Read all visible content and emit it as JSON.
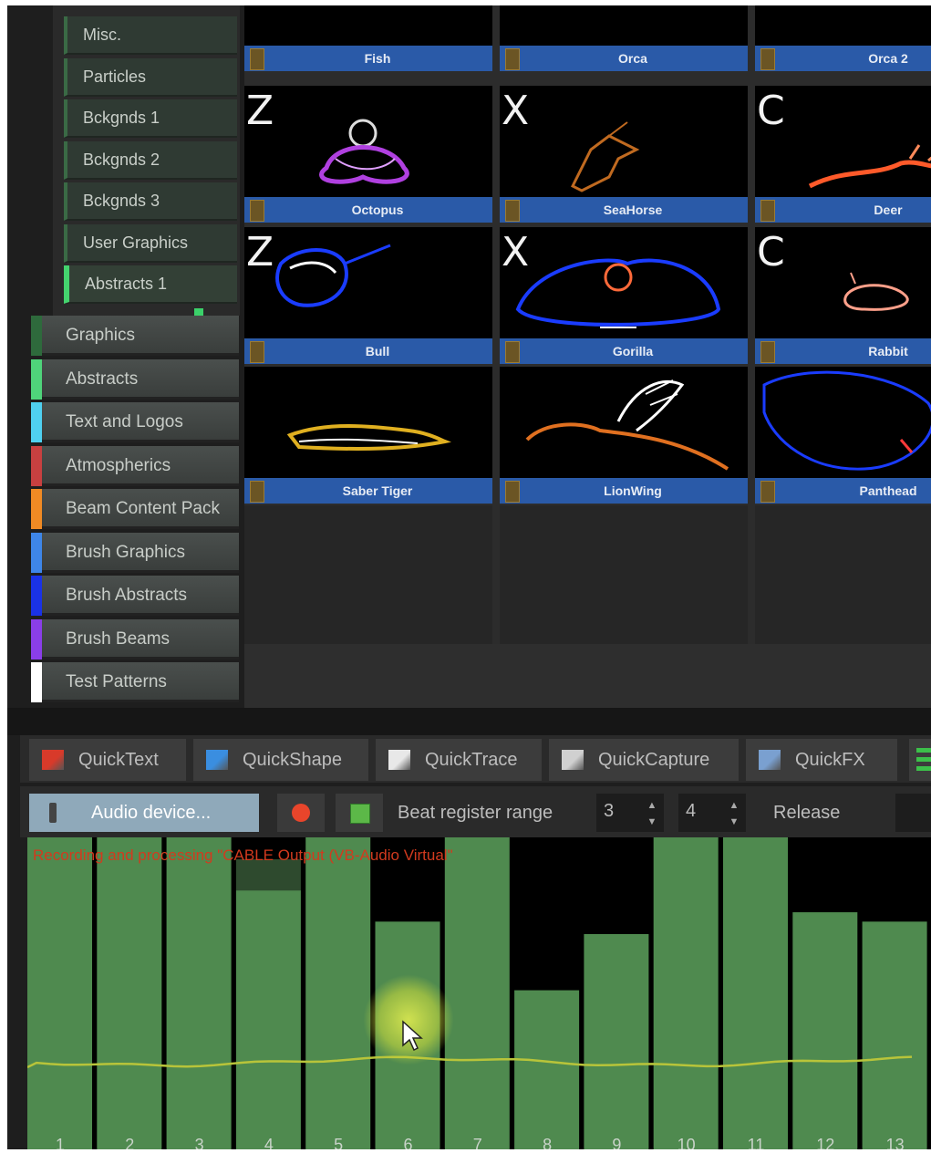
{
  "sub_categories": [
    {
      "label": "Misc.",
      "active": false
    },
    {
      "label": "Particles",
      "active": false
    },
    {
      "label": "Bckgnds 1",
      "active": false
    },
    {
      "label": "Bckgnds 2",
      "active": false
    },
    {
      "label": "Bckgnds 3",
      "active": false
    },
    {
      "label": "User Graphics",
      "active": false
    },
    {
      "label": "Abstracts 1",
      "active": true
    }
  ],
  "categories": [
    {
      "label": "Graphics",
      "color": "#2e6a3c"
    },
    {
      "label": "Abstracts",
      "color": "#4fd47a"
    },
    {
      "label": "Text and Logos",
      "color": "#4fd0f0"
    },
    {
      "label": "Atmospherics",
      "color": "#c84040"
    },
    {
      "label": "Beam Content Pack",
      "color": "#f08a24"
    },
    {
      "label": "Brush Graphics",
      "color": "#3e86e8"
    },
    {
      "label": "Brush Abstracts",
      "color": "#1a32e6"
    },
    {
      "label": "Brush Beams",
      "color": "#8a3ee8"
    },
    {
      "label": "Test Patterns",
      "color": "#ffffff"
    }
  ],
  "grid": {
    "rows": [
      [
        {
          "name": "Fish",
          "key": ""
        },
        {
          "name": "Orca",
          "key": ""
        },
        {
          "name": "Orca 2",
          "key": ""
        }
      ],
      [
        {
          "name": "Octopus",
          "key": "Z"
        },
        {
          "name": "SeaHorse",
          "key": "X"
        },
        {
          "name": "Deer",
          "key": "C"
        }
      ],
      [
        {
          "name": "Bull",
          "key": "Z"
        },
        {
          "name": "Gorilla",
          "key": "X"
        },
        {
          "name": "Rabbit",
          "key": "C"
        }
      ],
      [
        {
          "name": "Saber Tiger",
          "key": ""
        },
        {
          "name": "LionWing",
          "key": ""
        },
        {
          "name": "Panthead",
          "key": ""
        }
      ]
    ]
  },
  "quick_tools": [
    {
      "label": "QuickText",
      "icon": "quicktext-icon",
      "color": "#d83a2a"
    },
    {
      "label": "QuickShape",
      "icon": "quickshape-icon",
      "color": "#3a8ee0"
    },
    {
      "label": "QuickTrace",
      "icon": "quicktrace-icon",
      "color": "#e8e8e8"
    },
    {
      "label": "QuickCapture",
      "icon": "quickcapture-icon",
      "color": "#d0d0d0"
    },
    {
      "label": "QuickFX",
      "icon": "quickfx-icon",
      "color": "#7aa0d0"
    }
  ],
  "audio": {
    "device_button": "Audio device...",
    "beat_label": "Beat register range",
    "beat_from": "3",
    "beat_to": "4",
    "release_label": "Release",
    "status": "Recording and processing \"CABLE Output (VB-Audio Virtual\""
  },
  "analyzer": {
    "bands": [
      "1",
      "2",
      "3",
      "4",
      "5",
      "6",
      "7",
      "8",
      "9",
      "10",
      "11",
      "12",
      "13"
    ],
    "levels": [
      1.0,
      1.0,
      1.0,
      0.83,
      1.0,
      0.73,
      1.0,
      0.51,
      0.69,
      1.0,
      1.0,
      0.76,
      0.73
    ],
    "peaks": [
      1.0,
      1.0,
      1.0,
      0.93,
      1.0,
      0.73,
      1.0,
      0.51,
      0.69,
      1.0,
      1.0,
      0.76,
      0.73
    ],
    "bar_color": "#4f8a4f",
    "line_color": "#b8c43a"
  }
}
